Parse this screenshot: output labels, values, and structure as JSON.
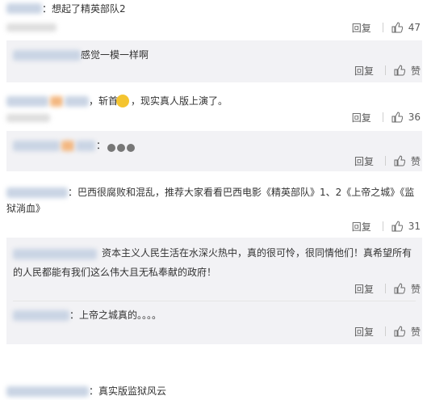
{
  "comments": [
    {
      "text": "：想起了精英部队2",
      "reply_label": "回复",
      "like_count": "47"
    },
    {
      "text": "感觉一模一样啊",
      "reply_label": "回复",
      "like_label": "赞"
    },
    {
      "text_a": "，斩首",
      "text_b": "，现实真人版上演了。",
      "reply_label": "回复",
      "like_count": "36"
    },
    {
      "text": "：",
      "reply_label": "回复",
      "like_label": "赞"
    },
    {
      "line1": "：巴西很腐败和混乱，推荐大家看看巴西电影《精英部队》1、2《上帝之城》《监",
      "line2": "狱淌血》",
      "reply_label": "回复",
      "like_count": "31"
    },
    {
      "line1": "资本主义人民生活在水深火热中，真的很可怜，很同情他们！真希望所有",
      "line2": "的人民都能有我们这么伟大且无私奉献的政府！",
      "reply_label": "回复",
      "like_label": "赞"
    },
    {
      "text": "：上帝之城真的。。。。",
      "reply_label": "回复",
      "like_label": "赞"
    },
    {
      "text": "：真实版监狱风云"
    }
  ]
}
